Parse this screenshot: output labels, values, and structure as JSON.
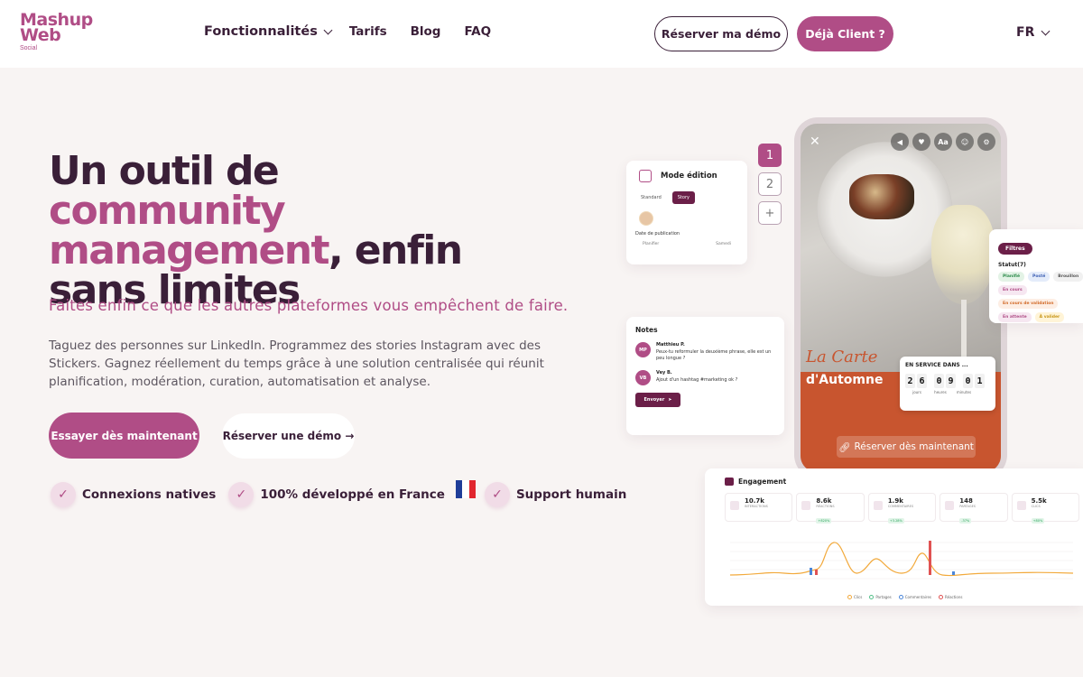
{
  "brand": {
    "logo_line1": "Mashup",
    "logo_line2": "Web",
    "logo_sub": "Social",
    "accent": "#b04d86",
    "dark": "#3a1f38"
  },
  "nav": {
    "items": [
      "Fonctionnalités",
      "Tarifs",
      "Blog",
      "FAQ"
    ],
    "demo_button": "Réserver ma démo",
    "client_button": "Déjà Client ?",
    "language": "FR"
  },
  "hero": {
    "title_part1": "Un outil de ",
    "title_highlight": "community management",
    "title_part2": ", enfin sans limites",
    "subtitle": "Faites enfin ce que les autres plateformes vous empêchent de faire.",
    "description": "Taguez des personnes sur LinkedIn. Programmez des stories Instagram avec des Stickers. Gagnez réellement du temps grâce à une solution centralisée qui réunit planification, modération, curation, automatisation et analyse.",
    "cta_primary": "Essayer dès maintenant",
    "cta_secondary": "Réserver une démo →",
    "features": [
      "Connexions natives",
      "100% développé en France",
      "Support humain"
    ]
  },
  "mockup": {
    "story_numbers": [
      "1",
      "2",
      "+"
    ],
    "edit_card": {
      "title": "Mode édition",
      "tab_standard": "Standard",
      "tab_story": "Story",
      "date_label": "Date de publication",
      "date_left": "Planifier",
      "date_right": "Samedi"
    },
    "notes_card": {
      "title": "Notes",
      "messages": [
        {
          "initials": "MP",
          "name": "Matthieu P.",
          "text": "Peux-tu reformuler la deuxième phrase, elle est un peu longue ?"
        },
        {
          "initials": "VB",
          "name": "Vey B.",
          "text": "Ajout d'un hashtag #marketing ok ?"
        }
      ],
      "send_label": "Envoyer"
    },
    "phone": {
      "title_line1": "La Carte",
      "title_line2": "d'Automne",
      "countdown_title": "EN SERVICE DANS ...",
      "countdown_digits": [
        "2",
        "6",
        "0",
        "9",
        "0",
        "1"
      ],
      "countdown_units": [
        "jours",
        "heures",
        "minutes"
      ],
      "cta": "Réserver dès maintenant",
      "top_icons": [
        "mute-icon",
        "heart-icon",
        "text-icon",
        "sticker-icon",
        "settings-icon"
      ],
      "top_icon_text": "Aa"
    },
    "filters_card": {
      "chip": "Filtres",
      "status_label": "Statut(7)",
      "tags": [
        {
          "label": "Planifié",
          "bg": "#e3f3e6",
          "fg": "#2a8a49"
        },
        {
          "label": "Posté",
          "bg": "#e4ecfa",
          "fg": "#3c5fb3"
        },
        {
          "label": "Brouillon",
          "bg": "#f1f1f1",
          "fg": "#555555"
        },
        {
          "label": "En cours",
          "bg": "#f6e7f1",
          "fg": "#b04d86"
        },
        {
          "label": "En cours de validation",
          "bg": "#fdeee4",
          "fg": "#d26a28"
        },
        {
          "label": "En attente",
          "bg": "#f6e7f1",
          "fg": "#b04d86"
        },
        {
          "label": "À valider",
          "bg": "#fff4d7",
          "fg": "#c79516"
        }
      ]
    },
    "engagement_card": {
      "title": "Engagement",
      "stats": [
        {
          "value": "10.7k",
          "label": "INTERACTIONS"
        },
        {
          "value": "8.6k",
          "label": "RÉACTIONS",
          "trend": "+820%"
        },
        {
          "value": "1.9k",
          "label": "COMMENTAIRES",
          "trend": "+3.28%"
        },
        {
          "value": "148",
          "label": "PARTAGES",
          "trend": "-37%"
        },
        {
          "value": "5.5k",
          "label": "CLICS",
          "trend": "+80%"
        }
      ],
      "legend": [
        "Clics",
        "Partages",
        "Commentaires",
        "Réactions"
      ],
      "legend_colors": [
        "#f2a93b",
        "#54c08a",
        "#4b86d9",
        "#e05252"
      ]
    }
  }
}
